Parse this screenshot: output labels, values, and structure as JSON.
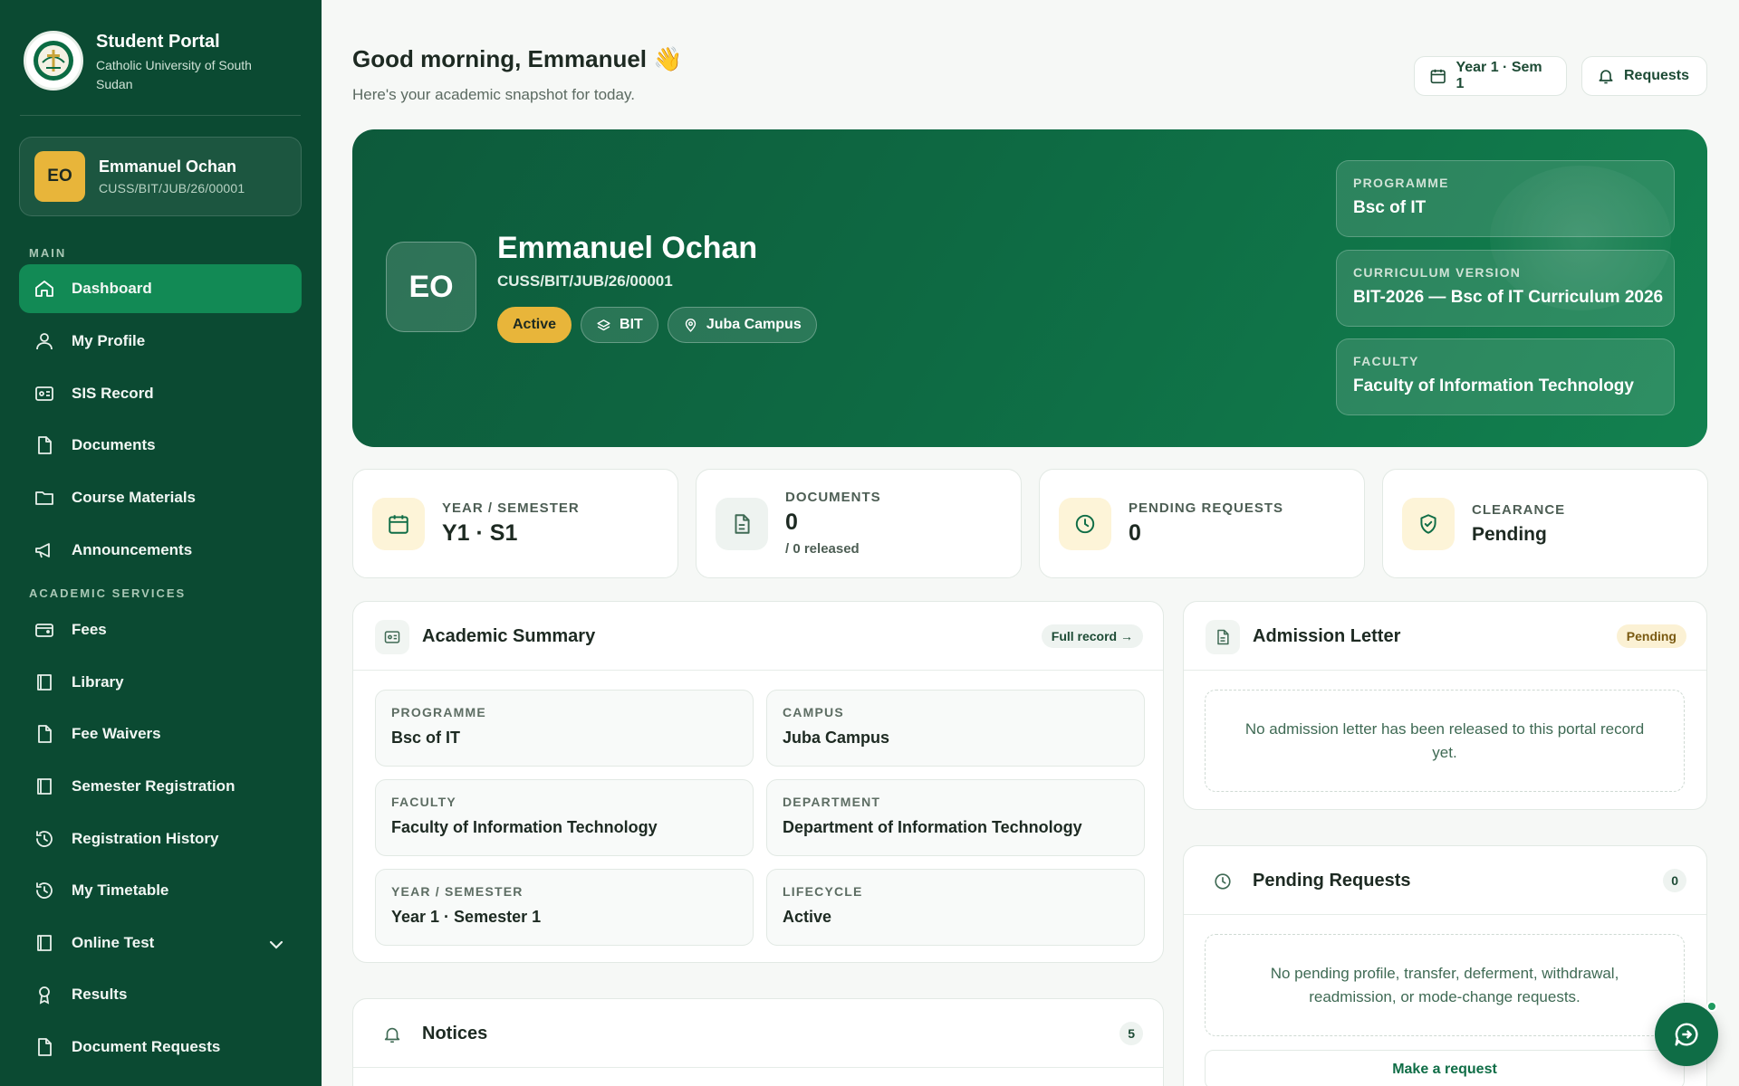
{
  "colors": {
    "sidebar_bg": "#0b4a32",
    "accent_green": "#128a55",
    "hero_green": "#0e6a43",
    "gold": "#e8b53a"
  },
  "brand": {
    "title": "Student Portal",
    "subtitle": "Catholic University of South Sudan",
    "logo_icon": "university-crest-icon"
  },
  "user": {
    "initials": "EO",
    "name": "Emmanuel Ochan",
    "id": "CUSS/BIT/JUB/26/00001"
  },
  "sidebar": {
    "section_main": "MAIN",
    "section_academic": "ACADEMIC SERVICES",
    "main_items": [
      {
        "label": "Dashboard",
        "icon": "home-icon",
        "active": true
      },
      {
        "label": "My Profile",
        "icon": "user-icon"
      },
      {
        "label": "SIS Record",
        "icon": "id-card-icon"
      },
      {
        "label": "Documents",
        "icon": "file-icon"
      },
      {
        "label": "Course Materials",
        "icon": "folder-icon"
      },
      {
        "label": "Announcements",
        "icon": "megaphone-icon"
      }
    ],
    "academic_items": [
      {
        "label": "Fees",
        "icon": "wallet-icon"
      },
      {
        "label": "Library",
        "icon": "book-icon"
      },
      {
        "label": "Fee Waivers",
        "icon": "file-icon"
      },
      {
        "label": "Semester Registration",
        "icon": "book-icon"
      },
      {
        "label": "Registration History",
        "icon": "history-icon"
      },
      {
        "label": "My Timetable",
        "icon": "history-icon"
      },
      {
        "label": "Online Test",
        "icon": "book-icon",
        "has_submenu": true
      },
      {
        "label": "Results",
        "icon": "award-icon"
      },
      {
        "label": "Document Requests",
        "icon": "file-icon"
      }
    ]
  },
  "header": {
    "greeting": "Good morning, Emmanuel 👋",
    "subtitle": "Here's your academic snapshot for today.",
    "term_button": "Year 1 · Sem 1",
    "requests_button": "Requests"
  },
  "hero": {
    "initials": "EO",
    "name": "Emmanuel Ochan",
    "id": "CUSS/BIT/JUB/26/00001",
    "status_tag": "Active",
    "programme_tag": "BIT",
    "campus_tag": "Juba Campus",
    "info": [
      {
        "label": "PROGRAMME",
        "value": "Bsc of IT"
      },
      {
        "label": "CURRICULUM VERSION",
        "value": "BIT-2026 — Bsc of IT Curriculum 2026"
      },
      {
        "label": "FACULTY",
        "value": "Faculty of Information Technology"
      }
    ]
  },
  "stats": [
    {
      "label": "YEAR / SEMESTER",
      "value": "Y1 · S1",
      "sub": "",
      "icon": "calendar-icon"
    },
    {
      "label": "DOCUMENTS",
      "value": "0",
      "sub": "/ 0 released",
      "icon": "document-icon"
    },
    {
      "label": "PENDING REQUESTS",
      "value": "0",
      "sub": "",
      "icon": "clock-icon"
    },
    {
      "label": "CLEARANCE",
      "value": "Pending",
      "sub": "",
      "icon": "shield-check-icon"
    }
  ],
  "academic_summary": {
    "title": "Academic Summary",
    "link": "Full record →",
    "fields": [
      {
        "label": "PROGRAMME",
        "value": "Bsc of IT"
      },
      {
        "label": "CAMPUS",
        "value": "Juba Campus"
      },
      {
        "label": "FACULTY",
        "value": "Faculty of Information Technology"
      },
      {
        "label": "DEPARTMENT",
        "value": "Department of Information Technology"
      },
      {
        "label": "YEAR / SEMESTER",
        "value": "Year 1 · Semester 1"
      },
      {
        "label": "LIFECYCLE",
        "value": "Active"
      }
    ]
  },
  "admission_letter": {
    "title": "Admission Letter",
    "badge": "Pending",
    "empty_text": "No admission letter has been released to this portal record yet."
  },
  "pending_requests": {
    "title": "Pending Requests",
    "count": "0",
    "empty_text": "No pending profile, transfer, deferment, withdrawal, readmission, or mode-change requests.",
    "action": "Make a request"
  },
  "notices": {
    "title": "Notices",
    "count": "5"
  }
}
